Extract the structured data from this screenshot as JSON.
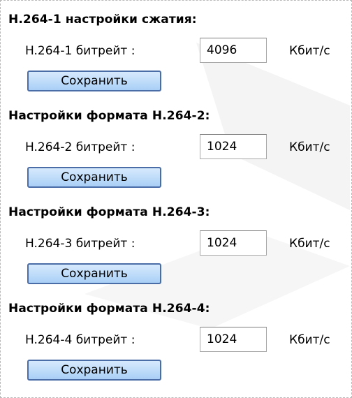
{
  "sections": [
    {
      "title": "H.264-1 настройки сжатия:",
      "label": "H.264-1 битрейт :",
      "value": "4096",
      "unit": "Кбит/с",
      "button": "Сохранить"
    },
    {
      "title": "Настройки формата H.264-2:",
      "label": "H.264-2 битрейт :",
      "value": "1024",
      "unit": "Кбит/с",
      "button": "Сохранить"
    },
    {
      "title": "Настройки формата H.264-3:",
      "label": "H.264-3 битрейт :",
      "value": "1024",
      "unit": "Кбит/с",
      "button": "Сохранить"
    },
    {
      "title": "Настройки формата H.264-4:",
      "label": "H.264-4 битрейт :",
      "value": "1024",
      "unit": "Кбит/с",
      "button": "Сохранить"
    }
  ],
  "colors": {
    "button_border": "#4a6da8",
    "button_fill_top": "#d7eafd",
    "button_fill_bottom": "#a9cff6",
    "panel_border": "#b8b8b8"
  }
}
